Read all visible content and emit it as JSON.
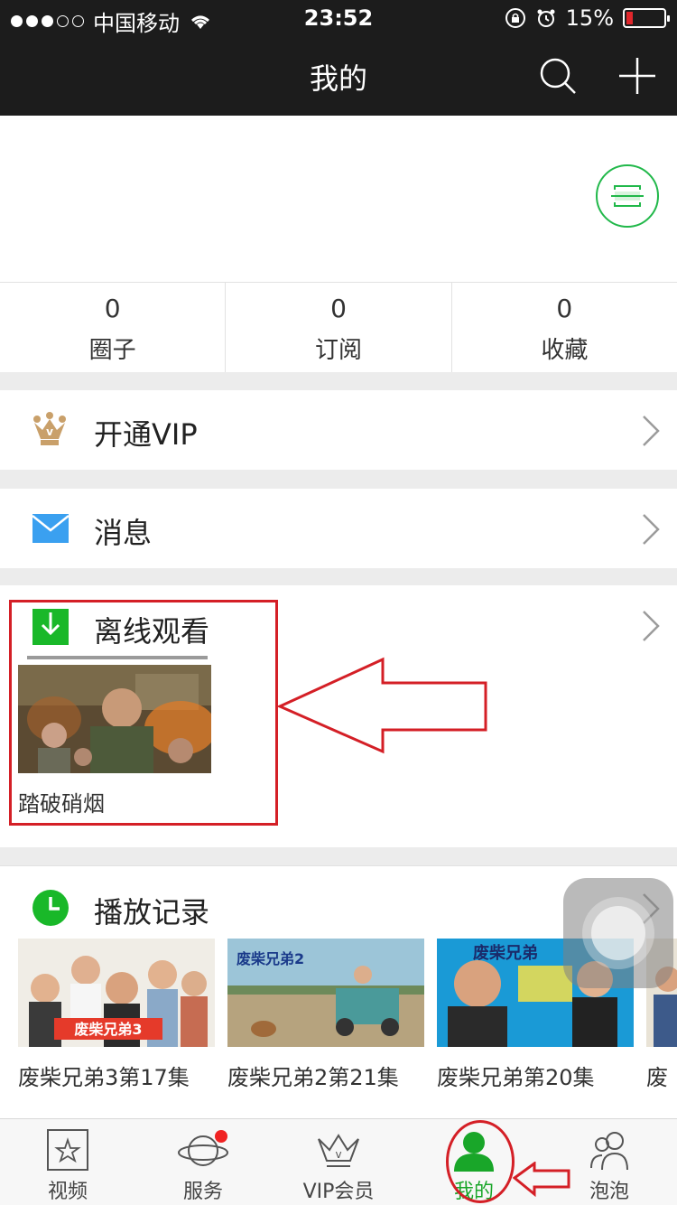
{
  "status_bar": {
    "carrier": "中国移动",
    "time": "23:52",
    "battery": "15%",
    "battery_level": 0.15
  },
  "nav": {
    "title": "我的",
    "icons": [
      "search-icon",
      "plus-icon"
    ]
  },
  "stats": [
    {
      "count": "0",
      "label": "圈子"
    },
    {
      "count": "0",
      "label": "订阅"
    },
    {
      "count": "0",
      "label": "收藏"
    }
  ],
  "menu": {
    "vip": "开通VIP",
    "messages": "消息"
  },
  "offline": {
    "title": "离线观看",
    "item": "踏破硝烟"
  },
  "history": {
    "title": "播放记录",
    "items": [
      "废柴兄弟3第17集",
      "废柴兄弟2第21集",
      "废柴兄弟第20集",
      "废"
    ]
  },
  "tabs": [
    {
      "label": "视频",
      "icon": "star-icon"
    },
    {
      "label": "服务",
      "icon": "planet-icon"
    },
    {
      "label": "VIP会员",
      "icon": "crown-icon"
    },
    {
      "label": "我的",
      "icon": "user-icon"
    },
    {
      "label": "泡泡",
      "icon": "bubble-icon"
    }
  ],
  "colors": {
    "nav_bg": "#1c1c1c",
    "accent_green": "#19a629",
    "annotation_red": "#d41f26",
    "vip_gold": "#c9a06a",
    "mail_blue": "#3aa0f0"
  }
}
